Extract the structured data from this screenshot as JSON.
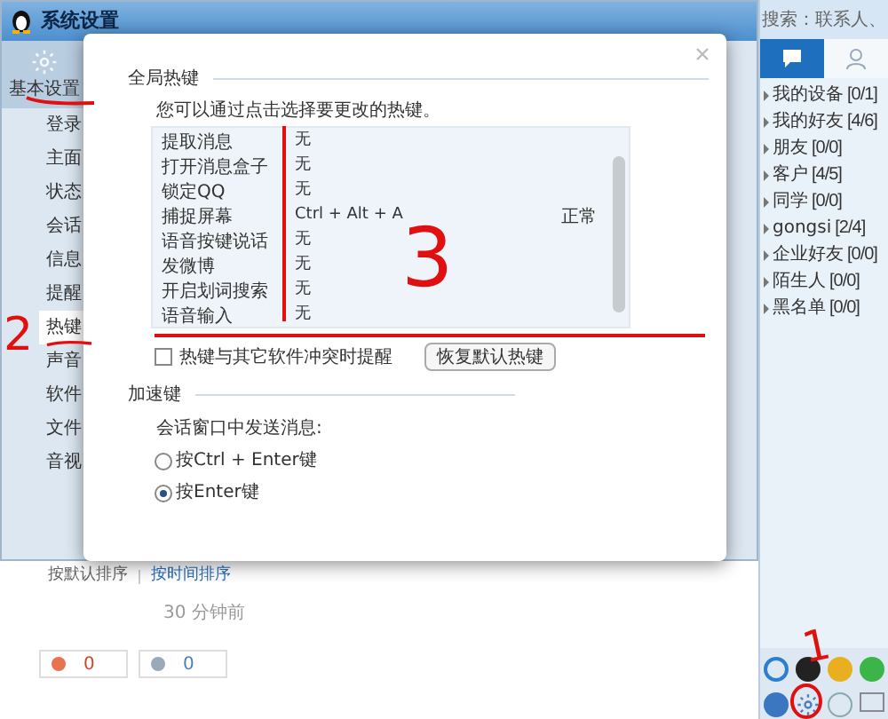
{
  "settings_window": {
    "title": "系统设置",
    "nav_header": {
      "label": "基本设置",
      "selected": true
    },
    "nav": [
      {
        "label": "登录",
        "selected": false
      },
      {
        "label": "主面",
        "selected": false
      },
      {
        "label": "状态",
        "selected": false
      },
      {
        "label": "会话",
        "selected": false
      },
      {
        "label": "信息",
        "selected": false
      },
      {
        "label": "提醒",
        "selected": false
      },
      {
        "label": "热键",
        "selected": true
      },
      {
        "label": "声音",
        "selected": false
      },
      {
        "label": "软件",
        "selected": false
      },
      {
        "label": "文件",
        "selected": false
      },
      {
        "label": "音视",
        "selected": false
      }
    ]
  },
  "dialog": {
    "global_hotkeys_title": "全局热键",
    "description": "您可以通过点击选择要更改的热键。",
    "hotkeys": [
      {
        "name": "提取消息",
        "key": "无"
      },
      {
        "name": "打开消息盒子",
        "key": "无"
      },
      {
        "name": "锁定QQ",
        "key": "无"
      },
      {
        "name": "捕捉屏幕",
        "key": "Ctrl + Alt + A",
        "status": "正常"
      },
      {
        "name": "语音按键说话",
        "key": "无"
      },
      {
        "name": "发微博",
        "key": "无"
      },
      {
        "name": "开启划词搜索",
        "key": "无"
      },
      {
        "name": "语音输入",
        "key": "无"
      }
    ],
    "conflict_checkbox": {
      "label": "热键与其它软件冲突时提醒",
      "checked": false
    },
    "restore_button": "恢复默认热键",
    "accelerator_title": "加速键",
    "send_label": "会话窗口中发送消息:",
    "send_options": [
      {
        "label": "按Ctrl + Enter键",
        "selected": false
      },
      {
        "label": "按Enter键",
        "selected": true
      }
    ]
  },
  "background_page": {
    "sort_options": [
      {
        "label": "按默认排序",
        "kind": "text"
      },
      {
        "label": "按时间排序",
        "kind": "link"
      }
    ],
    "time": "30 分钟前",
    "like_count": "0",
    "dislike_count": "0"
  },
  "contacts": {
    "search_placeholder": "搜索：联系人、",
    "tabs": [
      {
        "kind": "chat",
        "selected": true
      },
      {
        "kind": "contacts",
        "selected": false
      }
    ],
    "groups": [
      {
        "label": "我的设备",
        "count": "[0/1]"
      },
      {
        "label": "我的好友",
        "count": "[4/6]"
      },
      {
        "label": "朋友",
        "count": "[0/0]"
      },
      {
        "label": "客户",
        "count": "[4/5]"
      },
      {
        "label": "同学",
        "count": "[0/0]"
      },
      {
        "label": "gongsi",
        "count": "[2/4]"
      },
      {
        "label": "企业好友",
        "count": "[0/0]"
      },
      {
        "label": "陌生人",
        "count": "[0/0]"
      },
      {
        "label": "黑名单",
        "count": "[0/0]"
      }
    ]
  },
  "annotations": [
    "1",
    "2",
    "3"
  ]
}
